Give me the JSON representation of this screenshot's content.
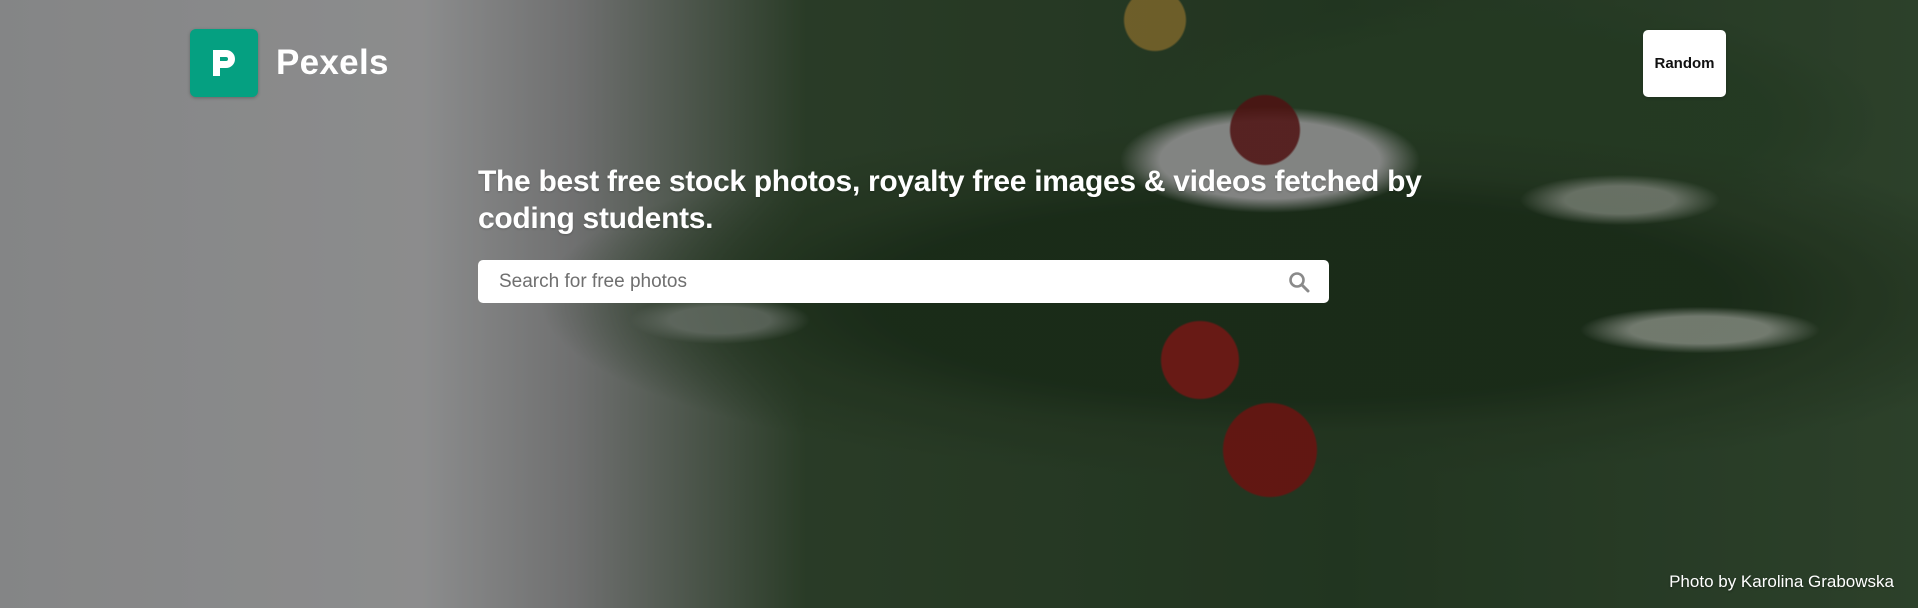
{
  "brand": {
    "name": "Pexels",
    "logo_icon": "pexels-p-icon",
    "accent_color": "#05a081"
  },
  "header": {
    "random_label": "Random"
  },
  "hero": {
    "tagline": "The best free stock photos, royalty free images & videos fetched by coding students.",
    "background_image": "christmas-wreath-photo"
  },
  "search": {
    "placeholder": "Search for free photos",
    "value": "",
    "icon": "search-icon"
  },
  "credit": {
    "text": "Photo by Karolina Grabowska"
  }
}
